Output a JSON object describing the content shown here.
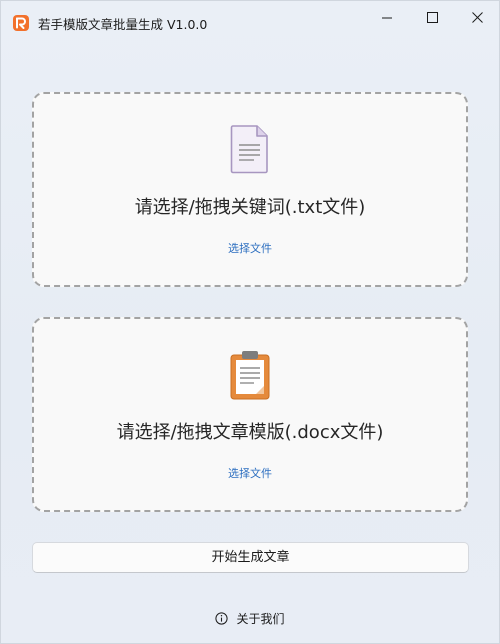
{
  "window": {
    "title": "若手模版文章批量生成 V1.0.0",
    "controls": [
      "minimize-icon",
      "maximize-icon",
      "close-icon"
    ]
  },
  "keyword_zone": {
    "label": "请选择/拖拽关键词(.txt文件)",
    "link": "选择文件",
    "icon": "document-icon"
  },
  "template_zone": {
    "label": "请选择/拖拽文章模版(.docx文件)",
    "link": "选择文件",
    "icon": "clipboard-icon"
  },
  "start_button": {
    "label": "开始生成文章"
  },
  "about": {
    "label": "关于我们",
    "icon": "info-icon"
  },
  "colors": {
    "accent_link": "#2d6fc0",
    "app_icon": "#f2712c",
    "clipboard": "#e58a3c",
    "document": "#b9a9cf"
  }
}
